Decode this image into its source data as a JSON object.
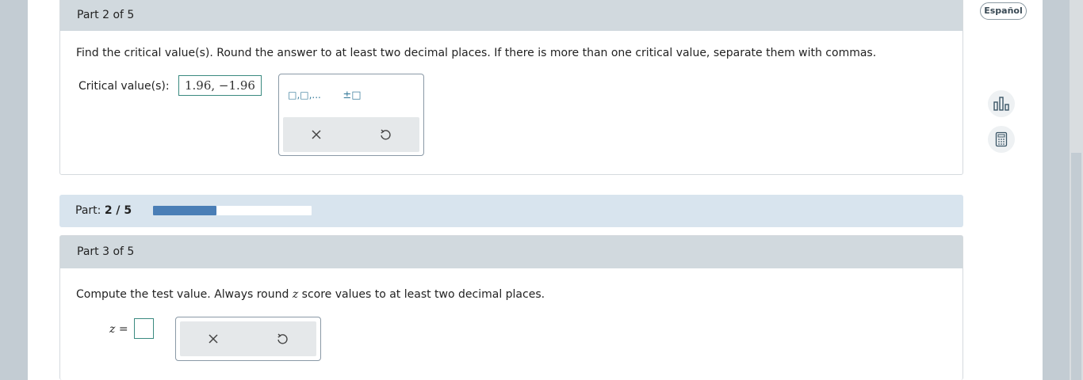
{
  "part2": {
    "header": "Part 2 of 5",
    "question": "Find the critical value(s). Round the answer to at least two decimal places. If there is more than one critical value, separate them with commas.",
    "answer_label": "Critical value(s):",
    "answer_value": "1.96, −1.96",
    "palette": {
      "list_button": "□,□,...",
      "plusminus_button": "±□",
      "clear_icon": "close-icon",
      "undo_icon": "undo-icon"
    }
  },
  "progress": {
    "label": "Part:",
    "value": "2 / 5",
    "fraction": 0.4,
    "fill_color": "#4a7eb6"
  },
  "part3": {
    "header": "Part 3 of 5",
    "question_pre": "Compute the test value. Always round ",
    "question_var": "z",
    "question_post": " score values to at least two decimal places.",
    "answer_var": "z",
    "answer_eq": " =",
    "answer_value": ""
  },
  "sidebar": {
    "language_button": "Español",
    "tools": [
      "chart-icon",
      "calculator-icon"
    ]
  },
  "colors": {
    "header_bg": "#d1d9de",
    "progress_bg": "#d8e4ee",
    "input_border": "#3a8a80"
  }
}
